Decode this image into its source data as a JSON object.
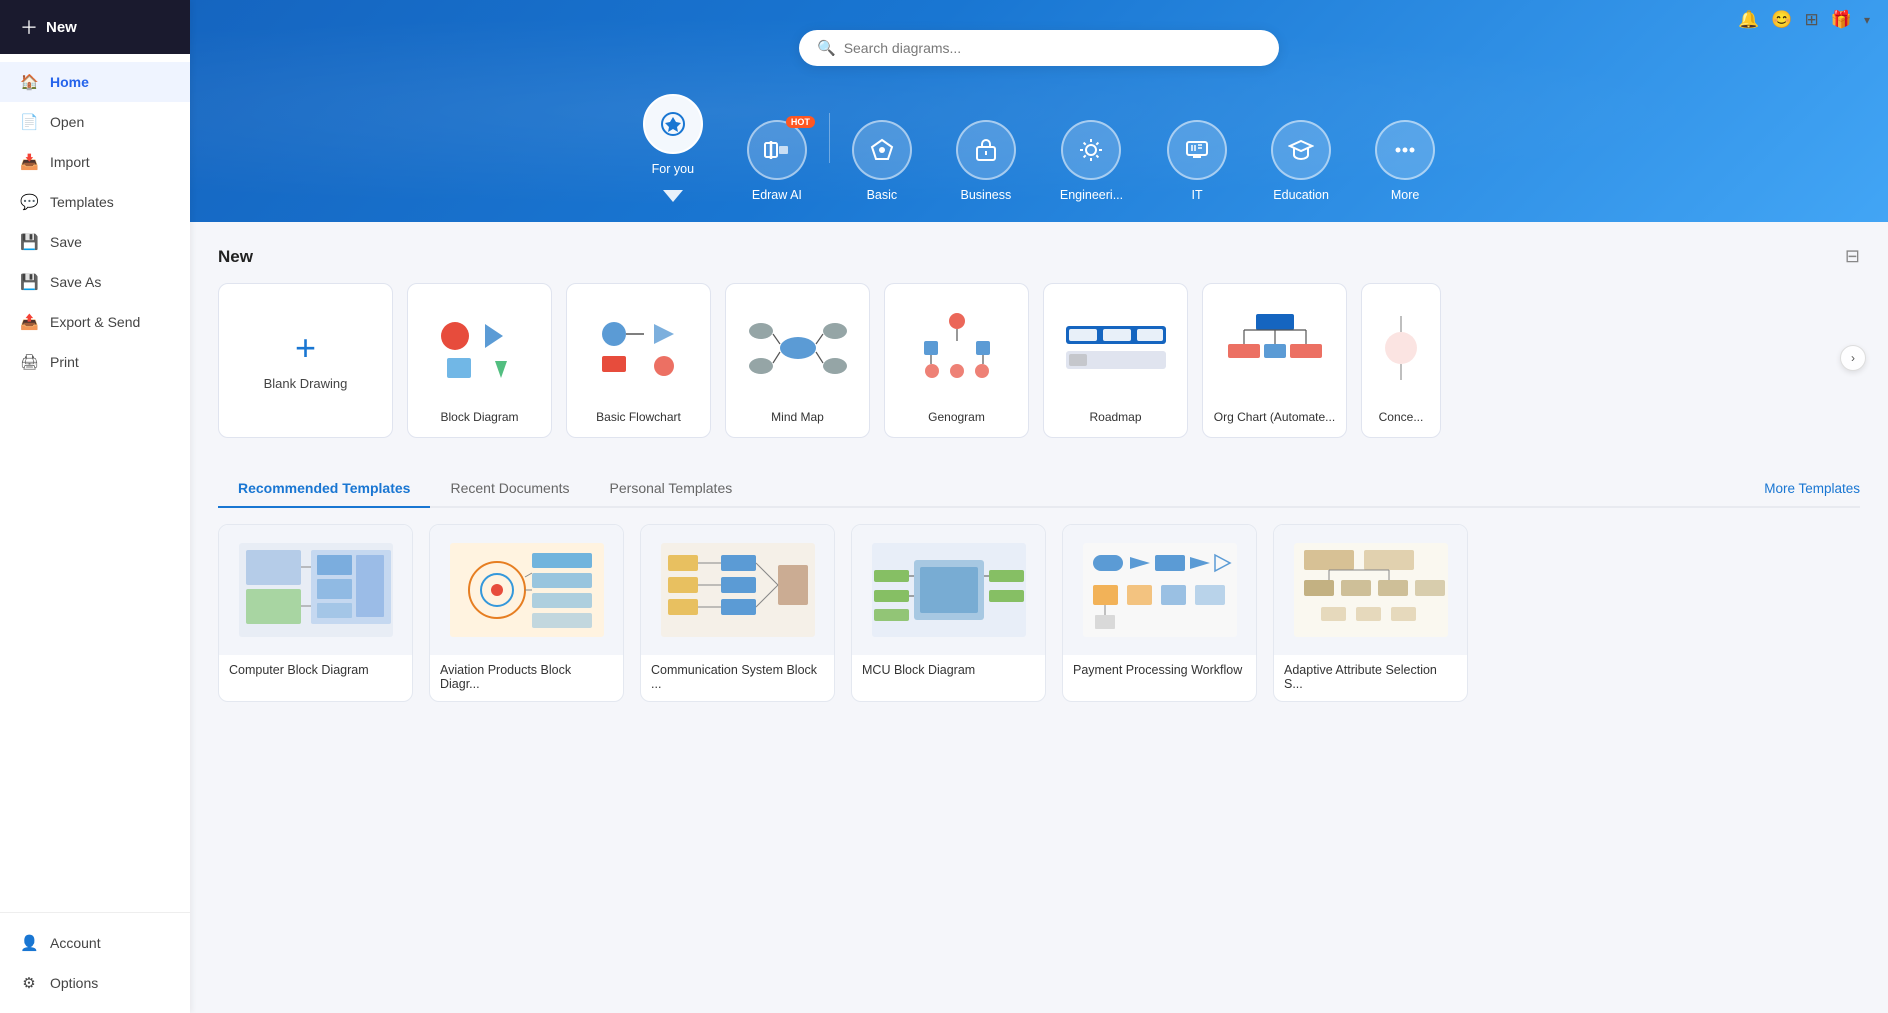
{
  "sidebar": {
    "new_label": "New",
    "items": [
      {
        "id": "home",
        "label": "Home",
        "icon": "🏠",
        "active": true
      },
      {
        "id": "open",
        "label": "Open",
        "icon": "📄"
      },
      {
        "id": "import",
        "label": "Import",
        "icon": "📥"
      },
      {
        "id": "templates",
        "label": "Templates",
        "icon": "💬"
      },
      {
        "id": "save",
        "label": "Save",
        "icon": "💾"
      },
      {
        "id": "save-as",
        "label": "Save As",
        "icon": "💾"
      },
      {
        "id": "export",
        "label": "Export & Send",
        "icon": "🖨"
      },
      {
        "id": "print",
        "label": "Print",
        "icon": "🖨"
      }
    ],
    "bottom_items": [
      {
        "id": "account",
        "label": "Account",
        "icon": "👤"
      },
      {
        "id": "options",
        "label": "Options",
        "icon": "⚙"
      }
    ]
  },
  "header": {
    "icons": [
      "bell",
      "user-circle",
      "grid-apps",
      "gift",
      "chevron-down"
    ]
  },
  "hero": {
    "search_placeholder": "Search diagrams...",
    "categories": [
      {
        "id": "for-you",
        "label": "For you",
        "icon": "✦",
        "active": true
      },
      {
        "id": "edraw-ai",
        "label": "Edraw AI",
        "icon": "//",
        "hot": true
      },
      {
        "id": "basic",
        "label": "Basic",
        "icon": "🏷"
      },
      {
        "id": "business",
        "label": "Business",
        "icon": "🏢"
      },
      {
        "id": "engineering",
        "label": "Engineeri...",
        "icon": "⚙"
      },
      {
        "id": "it",
        "label": "IT",
        "icon": "🖥"
      },
      {
        "id": "education",
        "label": "Education",
        "icon": "🎓"
      },
      {
        "id": "more",
        "label": "More",
        "icon": "⋯"
      }
    ]
  },
  "new_section": {
    "title": "New",
    "blank_label": "Blank Drawing",
    "templates": [
      {
        "id": "block-diagram",
        "label": "Block Diagram"
      },
      {
        "id": "basic-flowchart",
        "label": "Basic Flowchart"
      },
      {
        "id": "mind-map",
        "label": "Mind Map"
      },
      {
        "id": "genogram",
        "label": "Genogram"
      },
      {
        "id": "roadmap",
        "label": "Roadmap"
      },
      {
        "id": "org-chart",
        "label": "Org Chart (Automate..."
      },
      {
        "id": "concept",
        "label": "Conce..."
      }
    ]
  },
  "recommended": {
    "tabs": [
      {
        "id": "recommended",
        "label": "Recommended Templates",
        "active": true
      },
      {
        "id": "recent",
        "label": "Recent Documents"
      },
      {
        "id": "personal",
        "label": "Personal Templates"
      }
    ],
    "more_label": "More Templates",
    "templates": [
      {
        "id": "computer-block",
        "label": "Computer Block Diagram"
      },
      {
        "id": "aviation-block",
        "label": "Aviation Products Block Diagr..."
      },
      {
        "id": "comm-system",
        "label": "Communication System Block ..."
      },
      {
        "id": "mcu-block",
        "label": "MCU Block Diagram"
      },
      {
        "id": "payment-workflow",
        "label": "Payment Processing Workflow"
      },
      {
        "id": "adaptive-attr",
        "label": "Adaptive Attribute Selection S..."
      }
    ]
  }
}
